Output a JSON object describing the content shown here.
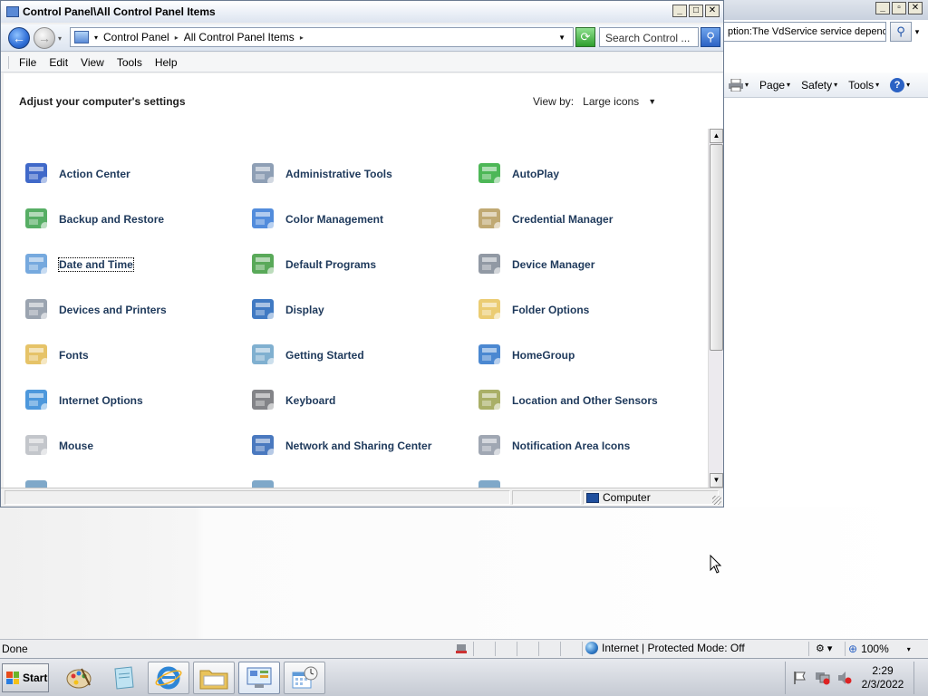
{
  "control_panel": {
    "title": "Control Panel\\All Control Panel Items",
    "breadcrumb": [
      "Control Panel",
      "All Control Panel Items"
    ],
    "search_placeholder": "Search Control ...",
    "menu": [
      "File",
      "Edit",
      "View",
      "Tools",
      "Help"
    ],
    "heading": "Adjust your computer's settings",
    "view_by_label": "View by:",
    "view_by_value": "Large icons",
    "items": [
      {
        "label": "Action Center",
        "icon": "flag-icon",
        "color": "#1f4fbf"
      },
      {
        "label": "Administrative Tools",
        "icon": "admin-tools-icon",
        "color": "#7a8ea8"
      },
      {
        "label": "AutoPlay",
        "icon": "autoplay-icon",
        "color": "#2eaa3a"
      },
      {
        "label": "Backup and Restore",
        "icon": "backup-icon",
        "color": "#3aa04a"
      },
      {
        "label": "Color Management",
        "icon": "color-management-icon",
        "color": "#3478d6"
      },
      {
        "label": "Credential Manager",
        "icon": "vault-icon",
        "color": "#b59a5a"
      },
      {
        "label": "Date and Time",
        "icon": "calendar-clock-icon",
        "color": "#5e9ad8"
      },
      {
        "label": "Default Programs",
        "icon": "default-programs-icon",
        "color": "#3c9a3c"
      },
      {
        "label": "Device Manager",
        "icon": "device-manager-icon",
        "color": "#7e8794"
      },
      {
        "label": "Devices and Printers",
        "icon": "printer-icon",
        "color": "#8a94a2"
      },
      {
        "label": "Display",
        "icon": "display-icon",
        "color": "#1e63b8"
      },
      {
        "label": "Folder Options",
        "icon": "folder-icon",
        "color": "#e7c35a"
      },
      {
        "label": "Fonts",
        "icon": "fonts-icon",
        "color": "#e2b84e"
      },
      {
        "label": "Getting Started",
        "icon": "getting-started-icon",
        "color": "#6aa2c8"
      },
      {
        "label": "HomeGroup",
        "icon": "homegroup-icon",
        "color": "#2b73c9"
      },
      {
        "label": "Internet Options",
        "icon": "internet-options-icon",
        "color": "#2e86d6"
      },
      {
        "label": "Keyboard",
        "icon": "keyboard-icon",
        "color": "#6d6f73"
      },
      {
        "label": "Location and Other Sensors",
        "icon": "sensor-icon",
        "color": "#9aa14c"
      },
      {
        "label": "Mouse",
        "icon": "mouse-icon",
        "color": "#b8bcc2"
      },
      {
        "label": "Network and Sharing Center",
        "icon": "network-icon",
        "color": "#2a62b4"
      },
      {
        "label": "Notification Area Icons",
        "icon": "notification-icon",
        "color": "#8f98a6"
      }
    ],
    "status_location": "Computer"
  },
  "ie": {
    "address_text": "ption:The VdService service depends",
    "cmdbar": [
      "Page",
      "Safety",
      "Tools"
    ],
    "status_text": "Done",
    "zone_text": "Internet | Protected Mode: Off",
    "zoom": "100%"
  },
  "taskbar": {
    "start_label": "Start",
    "clock_time": "2:29",
    "clock_date": "2/3/2022"
  }
}
